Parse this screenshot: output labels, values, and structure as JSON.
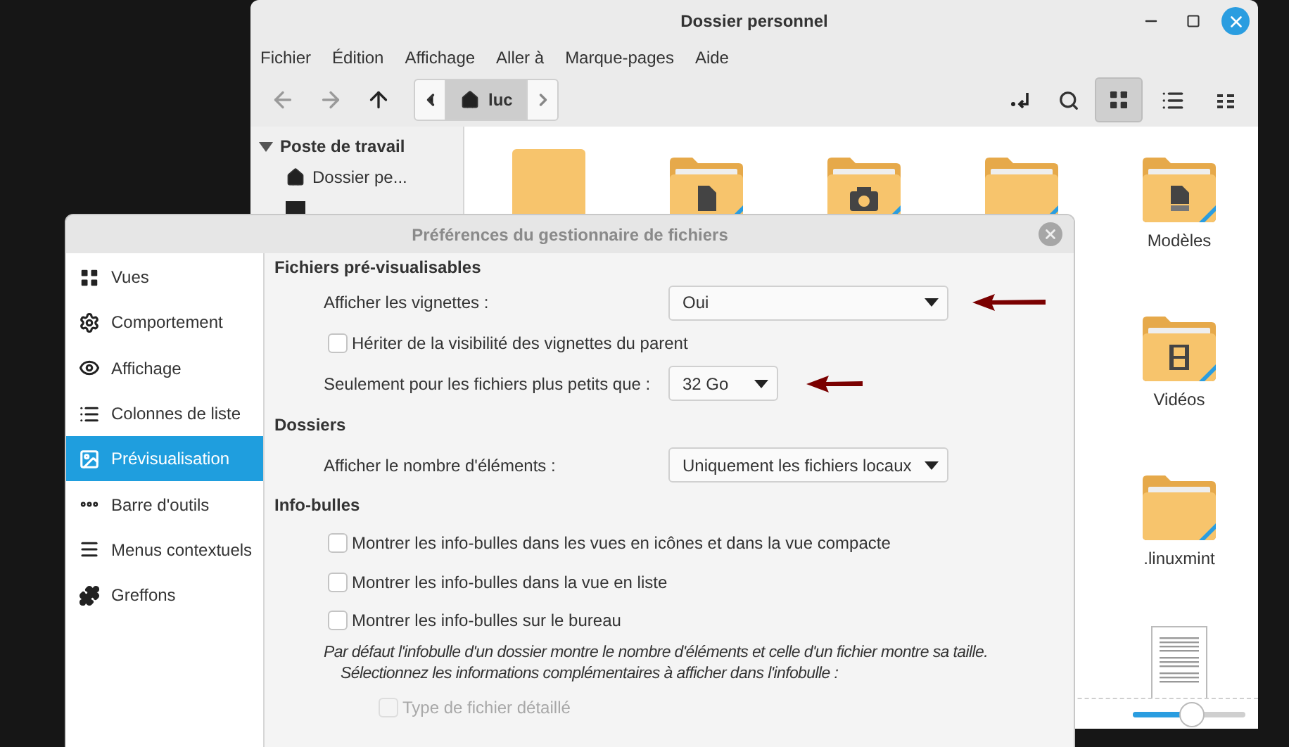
{
  "file_manager": {
    "title": "Dossier personnel",
    "menu": [
      "Fichier",
      "Édition",
      "Affichage",
      "Aller à",
      "Marque-pages",
      "Aide"
    ],
    "nav_buttons": [
      {
        "kind": "back",
        "disabled": true
      },
      {
        "kind": "forward",
        "disabled": true
      },
      {
        "kind": "up",
        "disabled": false
      }
    ],
    "path_bar": [
      {
        "label": "luc",
        "selected": true
      }
    ],
    "view_buttons": [
      {
        "kind": "icons",
        "selected": true
      },
      {
        "kind": "list",
        "selected": false
      },
      {
        "kind": "compact",
        "selected": false
      }
    ],
    "sidebar": {
      "header": "Poste de travail",
      "expanded": true,
      "items": [
        {
          "kind": "home",
          "label": "Dossier pe..."
        },
        {
          "kind": "desktop"
        }
      ]
    },
    "files": [
      {
        "kind": "plain"
      },
      {
        "kind": "documents"
      },
      {
        "kind": "pictures"
      },
      {
        "kind": "folder"
      },
      {
        "kind": "templates",
        "label": "Modèles"
      },
      {
        "kind": "videos",
        "label": "Vidéos"
      },
      {
        "kind": "folder",
        "label": ".linuxmint"
      },
      {
        "kind": "text-file"
      }
    ],
    "zoom_slider": {
      "level": 0.5
    }
  },
  "dialog": {
    "title": "Préférences du gestionnaire de fichiers",
    "sidebar": [
      {
        "kind": "grid",
        "label": "Vues",
        "selected": false
      },
      {
        "kind": "gear",
        "label": "Comportement",
        "selected": false
      },
      {
        "kind": "eye",
        "label": "Affichage",
        "selected": false
      },
      {
        "kind": "list",
        "label": "Colonnes de liste",
        "selected": false
      },
      {
        "kind": "image",
        "label": "Prévisualisation",
        "selected": true
      },
      {
        "kind": "dots",
        "label": "Barre d'outils",
        "selected": false
      },
      {
        "kind": "menu",
        "label": "Menus contextuels",
        "selected": false
      },
      {
        "kind": "puzzle",
        "label": "Greffons",
        "selected": false
      }
    ],
    "sections": [
      {
        "heading": "Fichiers pré-visualisables",
        "rows": [
          {
            "kind": "select",
            "label": "Afficher les vignettes :",
            "value": "Oui",
            "wide": true,
            "annotated": true
          },
          {
            "kind": "checkbox",
            "label": "Hériter de la visibilité des vignettes du parent",
            "checked": false,
            "disabled": false
          },
          {
            "kind": "select",
            "label": "Seulement pour les fichiers plus petits que :",
            "value": "32 Go",
            "wide": false,
            "annotated": true
          }
        ]
      },
      {
        "heading": "Dossiers",
        "rows": [
          {
            "kind": "select",
            "label": "Afficher le nombre d'éléments :",
            "value": "Uniquement les fichiers locaux",
            "wide": true,
            "annotated": false
          }
        ]
      },
      {
        "heading": "Info-bulles",
        "rows": [
          {
            "kind": "checkbox",
            "label": "Montrer les info-bulles dans les vues en icônes et dans la vue compacte",
            "checked": false,
            "disabled": false
          },
          {
            "kind": "checkbox",
            "label": "Montrer les info-bulles dans la vue en liste",
            "checked": false,
            "disabled": false
          },
          {
            "kind": "checkbox",
            "label": "Montrer les info-bulles sur le bureau",
            "checked": false,
            "disabled": false
          },
          {
            "kind": "note",
            "lines": [
              "Par défaut l'infobulle d'un dossier montre le nombre d'éléments et celle d'un fichier montre sa taille.",
              "Sélectionnez les informations complémentaires à afficher dans l'infobulle :"
            ]
          },
          {
            "kind": "subcheckbox",
            "label": "Type de fichier détaillé",
            "checked": false,
            "disabled": true
          }
        ]
      }
    ]
  }
}
